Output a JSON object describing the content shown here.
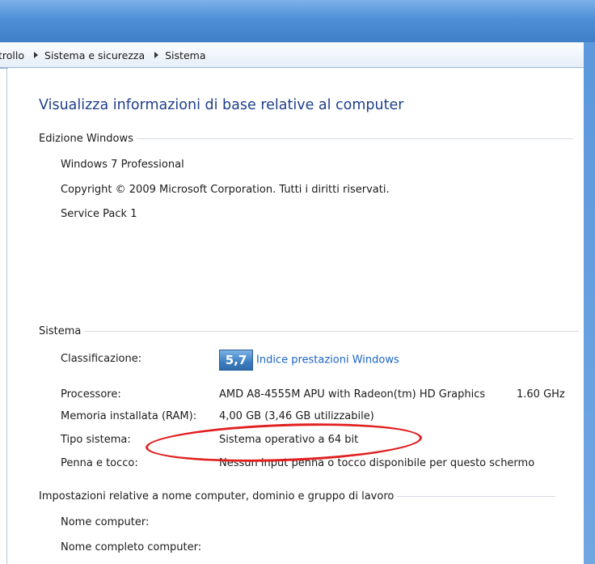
{
  "breadcrumb": {
    "items": [
      "trollo",
      "Sistema e sicurezza",
      "Sistema"
    ]
  },
  "main": {
    "heading": "Visualizza informazioni di base relative al computer"
  },
  "edition": {
    "title": "Edizione Windows",
    "name": "Windows 7 Professional",
    "copyright": "Copyright © 2009 Microsoft Corporation. Tutti i diritti riservati.",
    "service_pack": "Service Pack 1"
  },
  "system": {
    "title": "Sistema",
    "rating_label": "Classificazione:",
    "rating_score": "5,7",
    "rating_link": "Indice prestazioni Windows",
    "processor_label": "Processore:",
    "processor_value": "AMD A8-4555M APU with Radeon(tm) HD Graphics",
    "processor_speed": "1.60 GHz",
    "ram_label": "Memoria installata (RAM):",
    "ram_value": "4,00 GB (3,46 GB utilizzabile)",
    "type_label": "Tipo sistema:",
    "type_value": "Sistema operativo a 64 bit",
    "pen_label": "Penna e tocco:",
    "pen_value": "Nessun input penna o tocco disponibile per questo schermo"
  },
  "computer": {
    "title": "Impostazioni relative a nome computer, dominio e gruppo di lavoro",
    "name_label": "Nome computer:",
    "fullname_label": "Nome completo computer:"
  },
  "colors": {
    "heading": "#1e3f8a",
    "link": "#1a64c8",
    "annotation": "#e21f1f"
  }
}
